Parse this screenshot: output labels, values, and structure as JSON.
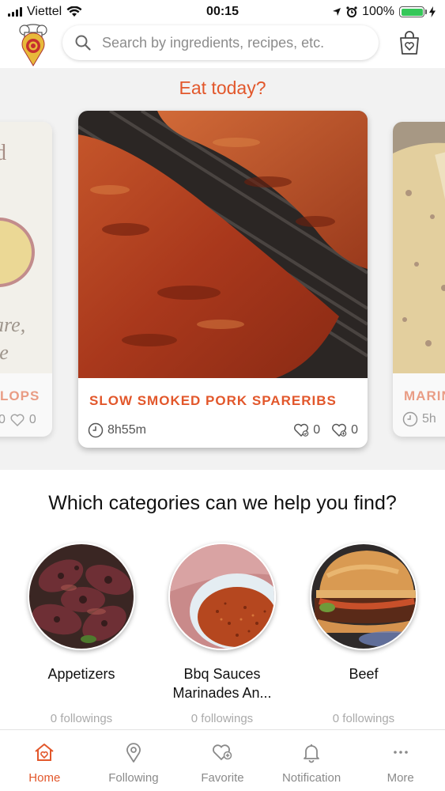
{
  "status_bar": {
    "carrier": "Viettel",
    "time": "00:15",
    "battery_percent": "100%",
    "battery_level": 1.0
  },
  "search": {
    "placeholder": "Search by ingredients, recipes, etc."
  },
  "featured": {
    "title": "Eat today?",
    "main_card": {
      "title": "SLOW SMOKED PORK SPARERIBS",
      "duration": "8h55m",
      "likes": "0",
      "favorites": "0"
    },
    "left_card": {
      "title": "LOPS",
      "image_text_1": "are,",
      "image_text_2": "le",
      "count_a": "0",
      "count_b": "0"
    },
    "right_card": {
      "title": "MARIN",
      "duration": "5h"
    }
  },
  "categories": {
    "heading": "Which categories can we help you find?",
    "items": [
      {
        "label": "Appetizers",
        "followings": "0 followings"
      },
      {
        "label": "Bbq Sauces Marinades An...",
        "followings": "0 followings"
      },
      {
        "label": "Beef",
        "followings": "0 followings"
      }
    ]
  },
  "tab_bar": {
    "items": [
      {
        "label": "Home",
        "icon": "home-icon",
        "active": true
      },
      {
        "label": "Following",
        "icon": "location-pin-icon",
        "active": false
      },
      {
        "label": "Favorite",
        "icon": "heart-plus-icon",
        "active": false
      },
      {
        "label": "Notification",
        "icon": "bell-icon",
        "active": false
      },
      {
        "label": "More",
        "icon": "more-dots-icon",
        "active": false
      }
    ]
  },
  "colors": {
    "accent": "#e2572b",
    "featured_bg": "#f2f2f2",
    "battery": "#35c759"
  }
}
